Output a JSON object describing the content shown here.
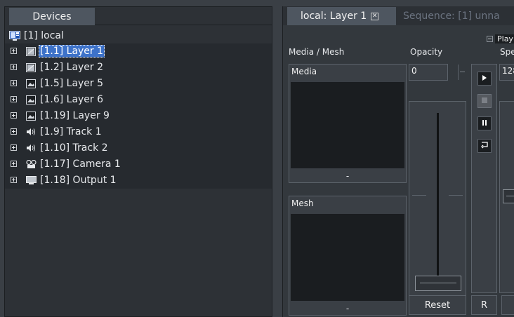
{
  "devices_panel": {
    "tab_label": "Devices",
    "root": {
      "label": "[1] local",
      "icon": "computer-icon"
    },
    "items": [
      {
        "label": "[1.1] Layer 1",
        "icon": "layer-icon",
        "selected": true
      },
      {
        "label": "[1.2] Layer 2",
        "icon": "layer-icon",
        "selected": false
      },
      {
        "label": "[1.5] Layer 5",
        "icon": "picture-icon",
        "selected": false
      },
      {
        "label": "[1.6] Layer 6",
        "icon": "picture-icon",
        "selected": false
      },
      {
        "label": "[1.19] Layer 9",
        "icon": "picture-icon",
        "selected": false
      },
      {
        "label": "[1.9] Track 1",
        "icon": "speaker-icon",
        "selected": false
      },
      {
        "label": "[1.10] Track 2",
        "icon": "speaker-icon",
        "selected": false
      },
      {
        "label": "[1.17] Camera 1",
        "icon": "camera-icon",
        "selected": false
      },
      {
        "label": "[1.18] Output 1",
        "icon": "monitor-icon",
        "selected": false
      }
    ]
  },
  "layer_panel": {
    "tabs": [
      {
        "label": "local: Layer 1",
        "active": true
      },
      {
        "label": "Sequence: [1] unna",
        "active": false
      }
    ],
    "playback_label": "Playba",
    "columns": {
      "media_mesh": "Media / Mesh",
      "opacity": "Opacity",
      "speed": "Spe"
    },
    "media_slot": {
      "title": "Media",
      "footer": "-"
    },
    "mesh_slot": {
      "title": "Mesh",
      "footer": "-"
    },
    "opacity": {
      "value": "0",
      "level": 0.0
    },
    "speed": {
      "value": "128",
      "level": 0.5
    },
    "transport_buttons": [
      "play-icon",
      "stop-icon",
      "pause-icon",
      "loop-icon"
    ],
    "reset_label": "Reset",
    "r_label": "R"
  },
  "colors": {
    "background": "#3a3f45",
    "panel": "#2d3136",
    "selection": "#3d72c9",
    "tab_active": "#4e5660",
    "screen": "#1a1d20"
  }
}
